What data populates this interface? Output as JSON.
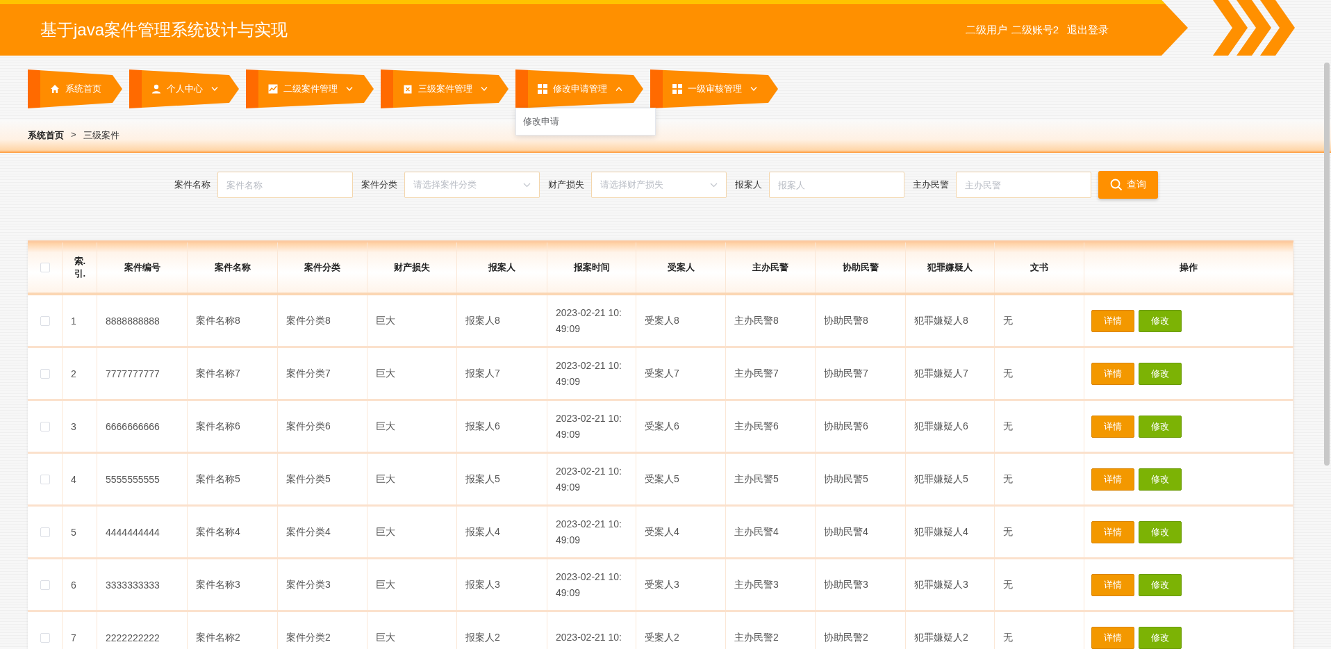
{
  "header": {
    "title": "基于java案件管理系统设计与实现",
    "user_role": "二级用户",
    "username": "二级账号2",
    "logout": "退出登录"
  },
  "nav": [
    {
      "label": "系统首页",
      "kind": "link"
    },
    {
      "label": "个人中心",
      "kind": "menu",
      "expanded": false
    },
    {
      "label": "二级案件管理",
      "kind": "menu",
      "expanded": false
    },
    {
      "label": "三级案件管理",
      "kind": "menu",
      "expanded": false
    },
    {
      "label": "修改申请管理",
      "kind": "menu",
      "expanded": true,
      "submenu": [
        "修改申请"
      ]
    },
    {
      "label": "一级审核管理",
      "kind": "menu",
      "expanded": false
    }
  ],
  "breadcrumb": {
    "items": [
      "系统首页",
      "三级案件"
    ],
    "separator": ">"
  },
  "search": {
    "fields": [
      {
        "label": "案件名称",
        "placeholder": "案件名称",
        "kind": "input"
      },
      {
        "label": "案件分类",
        "placeholder": "请选择案件分类",
        "kind": "select"
      },
      {
        "label": "财产损失",
        "placeholder": "请选择财产损失",
        "kind": "select"
      },
      {
        "label": "报案人",
        "placeholder": "报案人",
        "kind": "input"
      },
      {
        "label": "主办民警",
        "placeholder": "主办民警",
        "kind": "input"
      }
    ],
    "button": "查询"
  },
  "table": {
    "select_all_checked": false,
    "columns": [
      "索.引.",
      "案件编号",
      "案件名称",
      "案件分类",
      "财产损失",
      "报案人",
      "报案时间",
      "受案人",
      "主办民警",
      "协助民警",
      "犯罪嫌疑人",
      "文书",
      "操作"
    ],
    "rows": [
      {
        "checked": false,
        "cells": [
          "1",
          "8888888888",
          "案件名称8",
          "案件分类8",
          "巨大",
          "报案人8",
          "2023-02-21 10:49:09",
          "受案人8",
          "主办民警8",
          "协助民警8",
          "犯罪嫌疑人8",
          "无"
        ],
        "actions": [
          "详情",
          "修改"
        ]
      },
      {
        "checked": false,
        "cells": [
          "2",
          "7777777777",
          "案件名称7",
          "案件分类7",
          "巨大",
          "报案人7",
          "2023-02-21 10:49:09",
          "受案人7",
          "主办民警7",
          "协助民警7",
          "犯罪嫌疑人7",
          "无"
        ],
        "actions": [
          "详情",
          "修改"
        ]
      },
      {
        "checked": false,
        "cells": [
          "3",
          "6666666666",
          "案件名称6",
          "案件分类6",
          "巨大",
          "报案人6",
          "2023-02-21 10:49:09",
          "受案人6",
          "主办民警6",
          "协助民警6",
          "犯罪嫌疑人6",
          "无"
        ],
        "actions": [
          "详情",
          "修改"
        ]
      },
      {
        "checked": false,
        "cells": [
          "4",
          "5555555555",
          "案件名称5",
          "案件分类5",
          "巨大",
          "报案人5",
          "2023-02-21 10:49:09",
          "受案人5",
          "主办民警5",
          "协助民警5",
          "犯罪嫌疑人5",
          "无"
        ],
        "actions": [
          "详情",
          "修改"
        ]
      },
      {
        "checked": false,
        "cells": [
          "5",
          "4444444444",
          "案件名称4",
          "案件分类4",
          "巨大",
          "报案人4",
          "2023-02-21 10:49:09",
          "受案人4",
          "主办民警4",
          "协助民警4",
          "犯罪嫌疑人4",
          "无"
        ],
        "actions": [
          "详情",
          "修改"
        ]
      },
      {
        "checked": false,
        "cells": [
          "6",
          "3333333333",
          "案件名称3",
          "案件分类3",
          "巨大",
          "报案人3",
          "2023-02-21 10:49:09",
          "受案人3",
          "主办民警3",
          "协助民警3",
          "犯罪嫌疑人3",
          "无"
        ],
        "actions": [
          "详情",
          "修改"
        ]
      },
      {
        "checked": false,
        "cells": [
          "7",
          "2222222222",
          "案件名称2",
          "案件分类2",
          "巨大",
          "报案人2",
          "2023-02-21 10:",
          "受案人2",
          "主办民警2",
          "协助民警2",
          "犯罪嫌疑人2",
          "无"
        ],
        "actions": [
          "详情",
          "修改"
        ]
      }
    ]
  }
}
